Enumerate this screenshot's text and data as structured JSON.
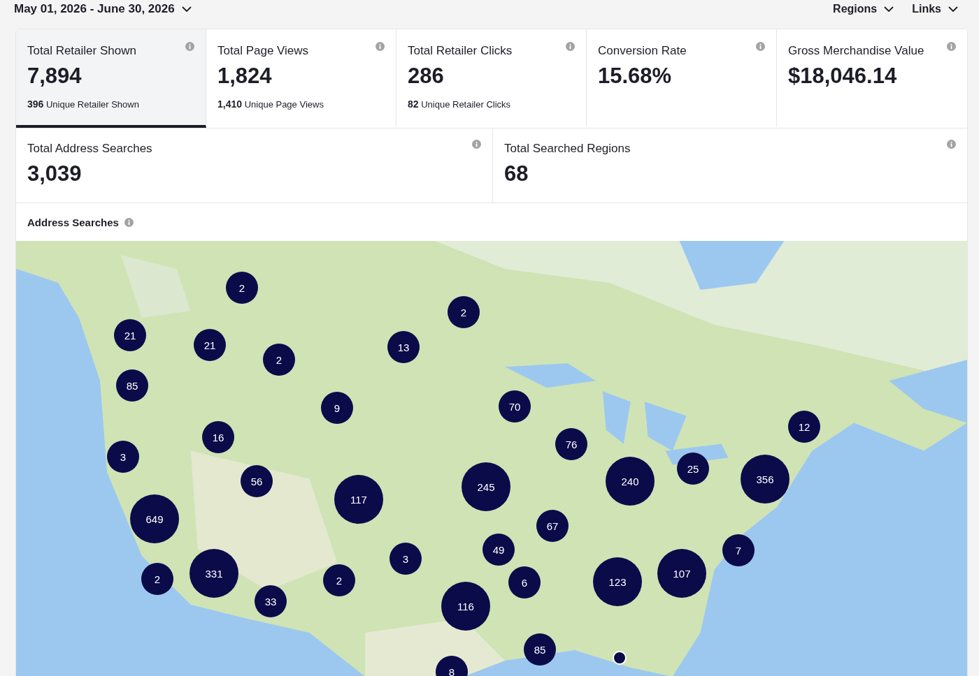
{
  "date_range": {
    "label": "May 01, 2026 - June 30, 2026"
  },
  "menus": [
    {
      "label": "Regions"
    },
    {
      "label": "Links"
    }
  ],
  "metric_cards": [
    {
      "title": "Total Retailer Shown",
      "value": "7,894",
      "sub_value": "396",
      "sub_label": "Unique Retailer Shown",
      "selected": true
    },
    {
      "title": "Total Page Views",
      "value": "1,824",
      "sub_value": "1,410",
      "sub_label": "Unique Page Views",
      "selected": false
    },
    {
      "title": "Total Retailer Clicks",
      "value": "286",
      "sub_value": "82",
      "sub_label": "Unique Retailer Clicks",
      "selected": false
    },
    {
      "title": "Conversion Rate",
      "value": "15.68%",
      "selected": false
    },
    {
      "title": "Gross Merchandise Value",
      "value": "$18,046.14",
      "selected": false
    }
  ],
  "summary_cards": [
    {
      "title": "Total Address Searches",
      "value": "3,039"
    },
    {
      "title": "Total Searched Regions",
      "value": "68"
    }
  ],
  "map_section": {
    "title": "Address Searches",
    "markers": [
      {
        "kind": "cluster",
        "count": "2"
      },
      {
        "kind": "cluster",
        "count": "21"
      },
      {
        "kind": "cluster",
        "count": "21"
      },
      {
        "kind": "cluster",
        "count": "2"
      },
      {
        "kind": "cluster",
        "count": "13"
      },
      {
        "kind": "cluster",
        "count": "2"
      },
      {
        "kind": "cluster",
        "count": "85"
      },
      {
        "kind": "cluster",
        "count": "9"
      },
      {
        "kind": "cluster",
        "count": "70"
      },
      {
        "kind": "cluster",
        "count": "16"
      },
      {
        "kind": "cluster",
        "count": "3"
      },
      {
        "kind": "cluster",
        "count": "76"
      },
      {
        "kind": "cluster",
        "count": "12"
      },
      {
        "kind": "cluster",
        "count": "56"
      },
      {
        "kind": "cluster",
        "count": "117"
      },
      {
        "kind": "cluster",
        "count": "245"
      },
      {
        "kind": "cluster",
        "count": "240"
      },
      {
        "kind": "cluster",
        "count": "25"
      },
      {
        "kind": "cluster",
        "count": "356"
      },
      {
        "kind": "cluster",
        "count": "649"
      },
      {
        "kind": "cluster",
        "count": "67"
      },
      {
        "kind": "cluster",
        "count": "49"
      },
      {
        "kind": "cluster",
        "count": "3"
      },
      {
        "kind": "cluster",
        "count": "7"
      },
      {
        "kind": "cluster",
        "count": "2"
      },
      {
        "kind": "cluster",
        "count": "331"
      },
      {
        "kind": "cluster",
        "count": "2"
      },
      {
        "kind": "cluster",
        "count": "6"
      },
      {
        "kind": "cluster",
        "count": "123"
      },
      {
        "kind": "cluster",
        "count": "107"
      },
      {
        "kind": "cluster",
        "count": "33"
      },
      {
        "kind": "cluster",
        "count": "116"
      },
      {
        "kind": "cluster",
        "count": "85"
      },
      {
        "kind": "cluster",
        "count": "8"
      },
      {
        "kind": "point"
      }
    ]
  }
}
